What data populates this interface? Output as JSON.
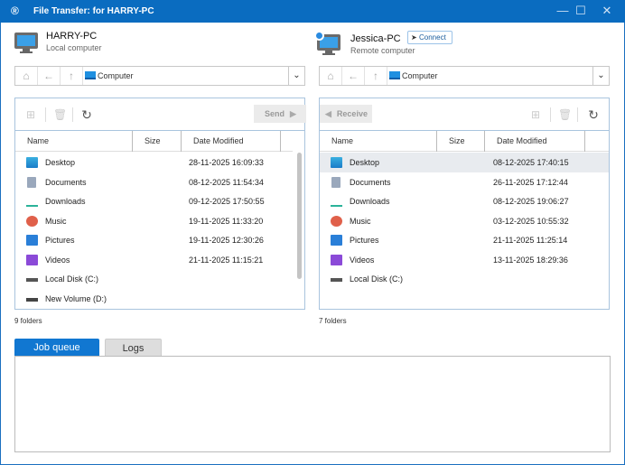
{
  "window": {
    "title": "File Transfer: for HARRY-PC",
    "minimize": "—",
    "maximize": "☐",
    "close": "✕"
  },
  "local": {
    "name": "HARRY-PC",
    "subtitle": "Local computer",
    "path": "Computer",
    "send_label": "Send",
    "columns": [
      "Name",
      "Size",
      "Date Modified"
    ],
    "items": [
      {
        "name": "Desktop",
        "size": "",
        "date": "28-11-2025 16:09:33",
        "icon": "desktop-folder-icon"
      },
      {
        "name": "Documents",
        "size": "",
        "date": "08-12-2025 11:54:34",
        "icon": "documents-folder-icon"
      },
      {
        "name": "Downloads",
        "size": "",
        "date": "09-12-2025 17:50:55",
        "icon": "downloads-folder-icon"
      },
      {
        "name": "Music",
        "size": "",
        "date": "19-11-2025 11:33:20",
        "icon": "music-folder-icon"
      },
      {
        "name": "Pictures",
        "size": "",
        "date": "19-11-2025 12:30:26",
        "icon": "pictures-folder-icon"
      },
      {
        "name": "Videos",
        "size": "",
        "date": "21-11-2025 11:15:21",
        "icon": "videos-folder-icon"
      },
      {
        "name": "Local Disk (C:)",
        "size": "",
        "date": "",
        "icon": "system-drive-icon"
      },
      {
        "name": "New Volume (D:)",
        "size": "",
        "date": "",
        "icon": "drive-icon"
      }
    ],
    "count": "9 folders"
  },
  "remote": {
    "name": "Jessica-PC",
    "subtitle": "Remote computer",
    "connect_label": "Connect",
    "path": "Computer",
    "receive_label": "Receive",
    "columns": [
      "Name",
      "Size",
      "Date Modified"
    ],
    "items": [
      {
        "name": "Desktop",
        "size": "",
        "date": "08-12-2025 17:40:15",
        "icon": "desktop-folder-icon",
        "selected": true
      },
      {
        "name": "Documents",
        "size": "",
        "date": "26-11-2025 17:12:44",
        "icon": "documents-folder-icon"
      },
      {
        "name": "Downloads",
        "size": "",
        "date": "08-12-2025 19:06:27",
        "icon": "downloads-folder-icon"
      },
      {
        "name": "Music",
        "size": "",
        "date": "03-12-2025 10:55:32",
        "icon": "music-folder-icon"
      },
      {
        "name": "Pictures",
        "size": "",
        "date": "21-11-2025 11:25:14",
        "icon": "pictures-folder-icon"
      },
      {
        "name": "Videos",
        "size": "",
        "date": "13-11-2025 18:29:36",
        "icon": "videos-folder-icon"
      },
      {
        "name": "Local Disk (C:)",
        "size": "",
        "date": "",
        "icon": "system-drive-icon"
      }
    ],
    "count": "7 folders"
  },
  "tabs": [
    {
      "label": "Job queue",
      "active": true
    },
    {
      "label": "Logs",
      "active": false
    }
  ],
  "colors": {
    "titlebar": "#0a6cc0",
    "accent": "#1177d1"
  }
}
